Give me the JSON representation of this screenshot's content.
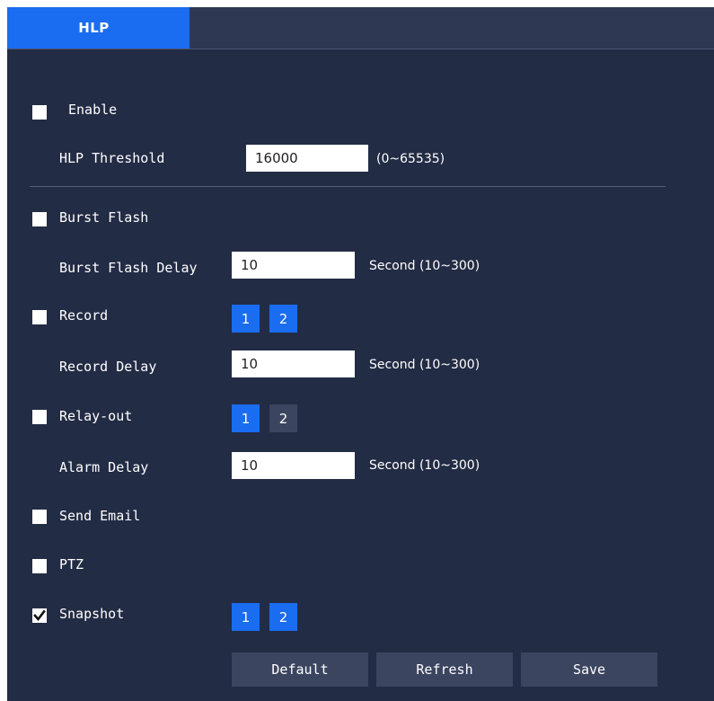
{
  "tab": {
    "label": "HLP"
  },
  "enable": {
    "label": "Enable",
    "checked": false
  },
  "threshold": {
    "label": "HLP Threshold",
    "value": "16000",
    "range": "(0~65535)"
  },
  "burst_flash": {
    "label": "Burst Flash",
    "checked": false
  },
  "burst_flash_delay": {
    "label": "Burst Flash Delay",
    "value": "10",
    "unit": "Second (10~300)"
  },
  "record": {
    "label": "Record",
    "checked": false,
    "channels": [
      {
        "label": "1",
        "selected": true
      },
      {
        "label": "2",
        "selected": true
      }
    ]
  },
  "record_delay": {
    "label": "Record Delay",
    "value": "10",
    "unit": "Second (10~300)"
  },
  "relay_out": {
    "label": "Relay-out",
    "checked": false,
    "channels": [
      {
        "label": "1",
        "selected": true
      },
      {
        "label": "2",
        "selected": false
      }
    ]
  },
  "alarm_delay": {
    "label": "Alarm Delay",
    "value": "10",
    "unit": "Second (10~300)"
  },
  "send_email": {
    "label": "Send Email",
    "checked": false
  },
  "ptz": {
    "label": "PTZ",
    "checked": false
  },
  "snapshot": {
    "label": "Snapshot",
    "checked": true,
    "channels": [
      {
        "label": "1",
        "selected": true
      },
      {
        "label": "2",
        "selected": true
      }
    ]
  },
  "buttons": {
    "default": "Default",
    "refresh": "Refresh",
    "save": "Save"
  },
  "colors": {
    "panel": "#232c45",
    "accent": "#1a6cf0",
    "button": "#3b4560"
  }
}
